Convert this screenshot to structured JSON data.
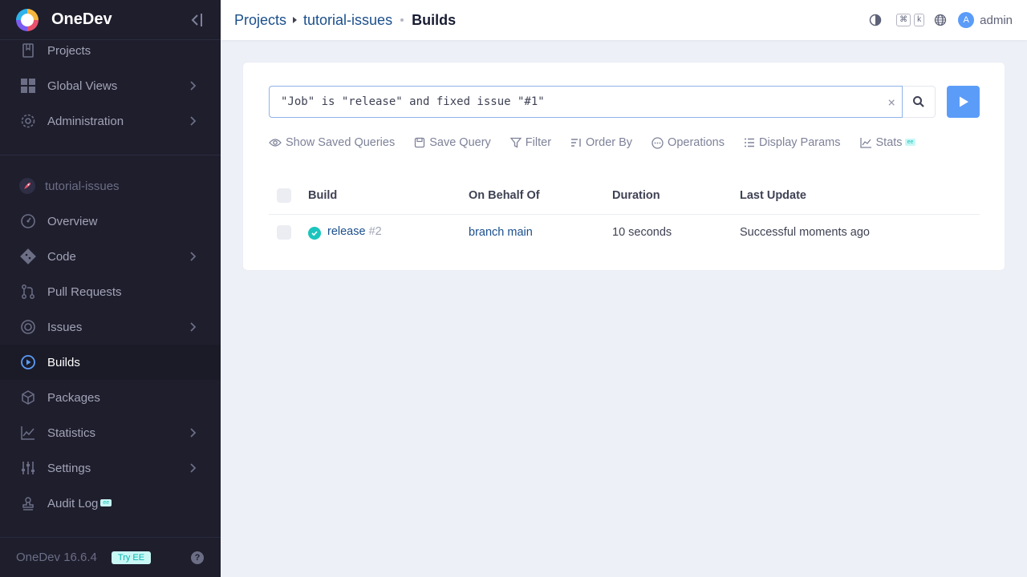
{
  "app": {
    "name": "OneDev",
    "version": "OneDev 16.6.4",
    "try_ee": "Try EE",
    "help_glyph": "?"
  },
  "nav_global": [
    {
      "label": "Projects",
      "icon": "bookmark-icon"
    },
    {
      "label": "Global Views",
      "icon": "grid-icon"
    },
    {
      "label": "Administration",
      "icon": "gear-icon"
    }
  ],
  "project": {
    "name": "tutorial-issues"
  },
  "nav_project": [
    {
      "label": "Overview",
      "icon": "gauge-icon"
    },
    {
      "label": "Code",
      "icon": "git-icon"
    },
    {
      "label": "Pull Requests",
      "icon": "pull-request-icon"
    },
    {
      "label": "Issues",
      "icon": "target-icon"
    },
    {
      "label": "Builds",
      "icon": "play-circle-icon",
      "active": true
    },
    {
      "label": "Packages",
      "icon": "package-icon"
    },
    {
      "label": "Statistics",
      "icon": "chart-icon"
    },
    {
      "label": "Settings",
      "icon": "sliders-icon"
    },
    {
      "label": "Audit Log",
      "icon": "stamp-icon",
      "badge": "ee"
    }
  ],
  "breadcrumb": {
    "root": "Projects",
    "project": "tutorial-issues",
    "page": "Builds"
  },
  "topbar": {
    "kbd_cmd": "⌘",
    "kbd_k": "k",
    "avatar_letter": "A",
    "username": "admin"
  },
  "query": {
    "value": "\"Job\" is \"release\" and fixed issue \"#1\"",
    "clear": "×"
  },
  "toolbar": {
    "show_saved": "Show Saved Queries",
    "save_query": "Save Query",
    "filter": "Filter",
    "order_by": "Order By",
    "operations": "Operations",
    "display_params": "Display Params",
    "stats": "Stats",
    "stats_badge": "ee"
  },
  "table": {
    "headers": [
      "Build",
      "On Behalf Of",
      "Duration",
      "Last Update"
    ],
    "rows": [
      {
        "job": "release",
        "number": "#2",
        "on_behalf_of": "branch main",
        "duration": "10 seconds",
        "last_update": "Successful moments ago",
        "status": "successful"
      }
    ]
  },
  "colors": {
    "sidebar_bg": "#1e1e2d",
    "accent": "#5b9cf8",
    "success": "#1bc5bd",
    "link": "#1b4f8c"
  }
}
